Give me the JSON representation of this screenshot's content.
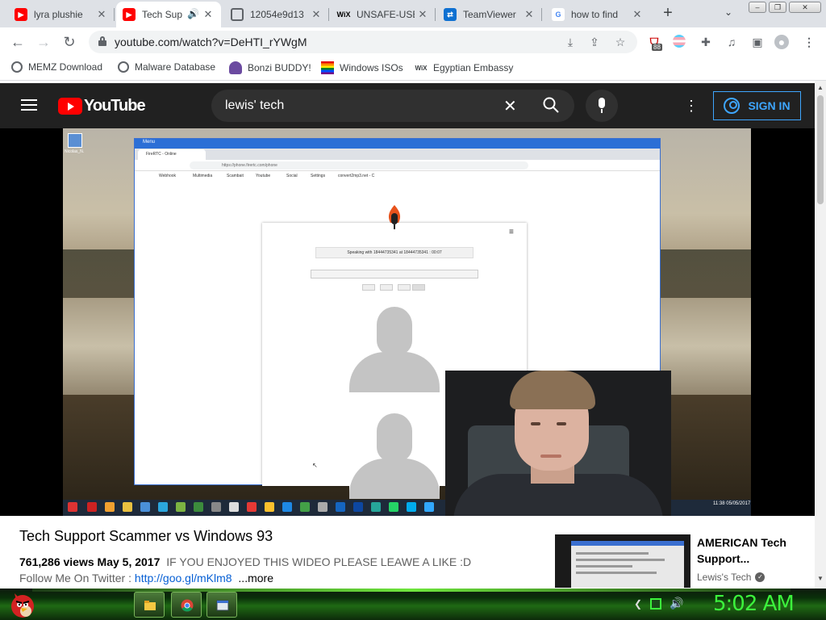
{
  "browser": {
    "tabs": [
      {
        "label": "lyra plushie",
        "icon": "youtube-icon",
        "active": false
      },
      {
        "label": "Tech Sup",
        "icon": "youtube-icon",
        "active": true,
        "audio": true
      },
      {
        "label": "12054e9d13",
        "icon": "globe-icon",
        "active": false
      },
      {
        "label": "UNSAFE-USE",
        "icon": "wix-icon",
        "active": false
      },
      {
        "label": "TeamViewer",
        "icon": "teamviewer-icon",
        "active": false
      },
      {
        "label": "how to find",
        "icon": "google-icon",
        "active": false
      }
    ],
    "new_tab_symbol": "+",
    "tab_search_symbol": "⌄",
    "url": "youtube.com/watch?v=DeHTI_rYWgM",
    "extension_badge": "88",
    "bookmarks": [
      {
        "label": "MEMZ Download",
        "icon": "globe-icon"
      },
      {
        "label": "Malware Database",
        "icon": "globe-icon"
      },
      {
        "label": "Bonzi BUDDY!",
        "icon": "bonzi-icon"
      },
      {
        "label": "Windows ISOs",
        "icon": "rainbow-flag-icon"
      },
      {
        "label": "Egyptian Embassy",
        "icon": "wix-icon"
      }
    ]
  },
  "youtube": {
    "logo_text": "YouTube",
    "search_query": "lewis' tech",
    "sign_in_label": "SIGN IN",
    "video": {
      "title": "Tech Support Scammer vs Windows 93",
      "views": "761,286 views",
      "date": "May 5, 2017",
      "description": "IF YOU ENJOYED THIS WIDEO PLEASE LEAWE A LIKE :D",
      "follow_prefix": "Follow Me On Twitter :",
      "follow_link": "http://goo.gl/mKlm8",
      "more_label": "...more"
    },
    "recommendation": {
      "title": "AMERICAN Tech Support...",
      "channel": "Lewis's Tech"
    },
    "frame": {
      "window_title": "Menu",
      "tab_label": "FireRTC - Online",
      "url": "https://phone.firertc.com/phone",
      "bookmarks": [
        "Webhook",
        "Multimedia",
        "Scambait",
        "Youtube",
        "Social",
        "Settings",
        "convert2mp3.net - C"
      ],
      "call_status": "Speaking with 18444735341 at 18444735341 : 00:07",
      "desktop_label": "Nicolas_N.",
      "clock": "11:38\n05/05/2017"
    }
  },
  "taskbar": {
    "clock": "5:02 AM",
    "apps": [
      "file-explorer-icon",
      "chrome-icon",
      "window-icon"
    ]
  },
  "colors": {
    "youtube_red": "#ff0000",
    "youtube_dark": "#212121",
    "signin_blue": "#3ea6ff",
    "clock_green": "#3cf23c"
  }
}
